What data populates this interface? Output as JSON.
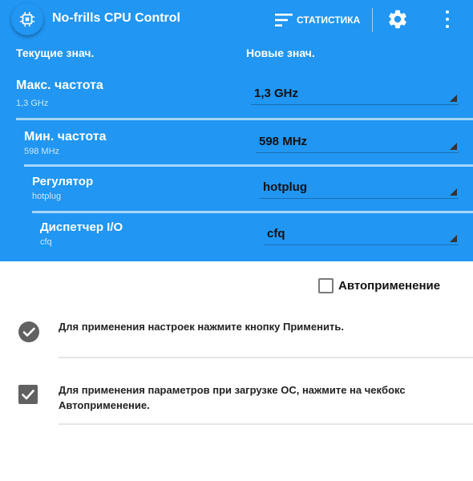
{
  "app": {
    "title": "No-frills CPU Control",
    "icon": "cpu-chip-icon"
  },
  "toolbar": {
    "stats_label": "СТАТИСТИКА",
    "stats_icon": "sort-lines-icon",
    "settings_icon": "gear-icon",
    "menu_icon": "overflow-menu-icon"
  },
  "columns": {
    "current": "Текущие знач.",
    "new": "Новые знач."
  },
  "rows": [
    {
      "label": "Макс. частота",
      "current": "1,3 GHz",
      "new": "1,3 GHz"
    },
    {
      "label": "Мин. частота",
      "current": "598 MHz",
      "new": "598 MHz"
    },
    {
      "label": "Регулятор",
      "current": "hotplug",
      "new": "hotplug"
    },
    {
      "label": "Диспетчер I/O",
      "current": "cfq",
      "new": "cfq"
    }
  ],
  "autoapply": {
    "label": "Автоприменение",
    "checked": false
  },
  "info": [
    {
      "icon": "check-circle-icon",
      "text": "Для применения настроек нажмите кнопку Применить."
    },
    {
      "icon": "checkbox-checked-icon",
      "text": "Для применения параметров при загрузке ОС, нажмите на чекбокс Автоприменение."
    }
  ],
  "colors": {
    "accent": "#2196f3",
    "text_dark": "#222222",
    "icon_gray": "#616161"
  }
}
